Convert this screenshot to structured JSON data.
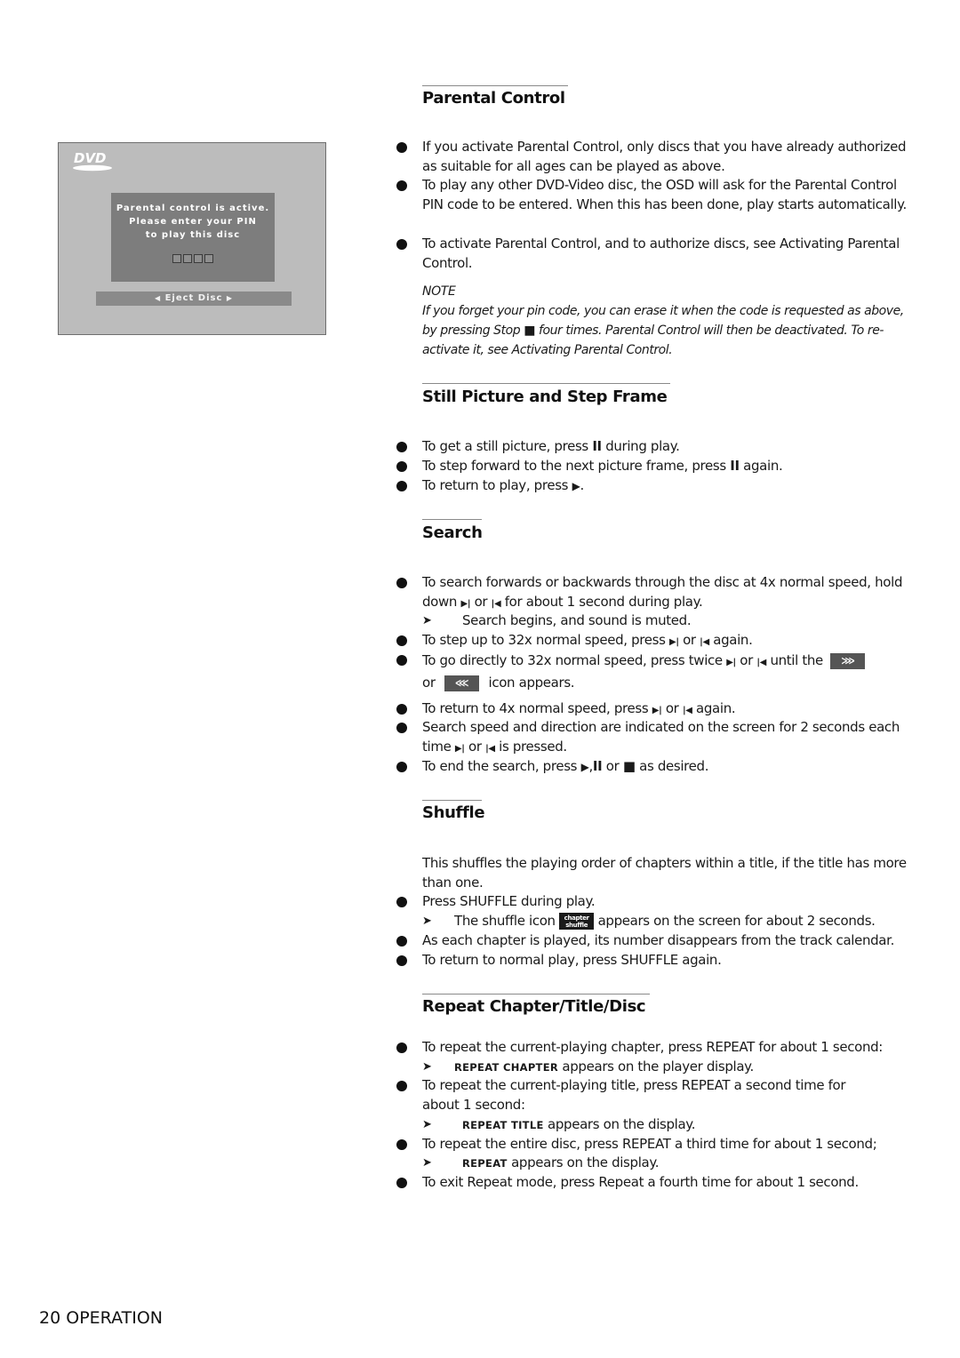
{
  "osd": {
    "logo": "DVD",
    "dialog_lines": [
      "Parental control is active.",
      "Please enter your PIN",
      "to play this disc"
    ],
    "pin_digits": 4,
    "eject_label": "Eject Disc"
  },
  "sections": {
    "parental": {
      "title": "Parental Control",
      "bullets": [
        "If you activate Parental Control, only discs that you have already authorized as suitable for all ages can be played as above.",
        "To play any other DVD-Video disc, the OSD will ask for the Parental Control PIN code to be entered. When this has been done, play starts automatically.",
        "To activate Parental Control, and to authorize discs, see Activating Parental Control."
      ],
      "note_heading": "NOTE",
      "note_part1": "If you forget your pin code, you can erase it when the code is requested as above, by pressing Stop",
      "note_symbol": "■",
      "note_part2": "four times. Parental Control will then be deactivated. To re-activate it, see Activating Parental Control."
    },
    "still": {
      "title": "Still Picture and Step Frame",
      "b1_a": "To get a still picture, press",
      "b1_sym": "II",
      "b1_b": "during play.",
      "b2_a": "To step forward to the next picture frame, press",
      "b2_sym": "II",
      "b2_b": "again.",
      "b3_a": "To return to play, press",
      "b3_sym": "▶",
      "b3_b": "."
    },
    "search": {
      "title": "Search",
      "next_sym": "▶|",
      "prev_sym": "|◀",
      "b1_a": "To search forwards or backwards through the disc at 4x normal speed, hold down",
      "b1_or": "or",
      "b1_b": "for about 1 second during play.",
      "b1_sub": "Search begins, and sound is muted.",
      "b2_a": "To step up to 32x normal speed, press",
      "b2_or": "or",
      "b2_b": "again.",
      "b3_a": "To go directly to 32x normal speed, press twice",
      "b3_or": "or",
      "b3_b": "until the",
      "b3_ff_icon": "⋙",
      "b3_or2": "or",
      "b3_rw_icon": "⋘",
      "b3_c": "icon appears.",
      "b4_a": "To return to 4x normal speed, press",
      "b4_or": "or",
      "b4_b": "again.",
      "b5_a": "Search speed and direction are indicated on the screen for 2 seconds each time",
      "b5_or": "or",
      "b5_b": "is pressed.",
      "b6_a": "To end the search, press",
      "b6_play": "▶",
      "b6_pause": "II",
      "b6_or": "or",
      "b6_stop": "■",
      "b6_b": "as desired."
    },
    "shuffle": {
      "title": "Shuffle",
      "intro": "This shuffles the playing order of chapters within a title, if the title has more than one.",
      "b1": "Press SHUFFLE during play.",
      "b1_sub_a": "The shuffle icon",
      "icon_line1": "chapter",
      "icon_line2": "shuffle",
      "b1_sub_b": "appears on the screen for about 2 seconds.",
      "b2": "As each chapter is played, its number disappears from the track calendar.",
      "b3": "To return to normal play, press SHUFFLE again."
    },
    "repeat": {
      "title": "Repeat Chapter/Title/Disc",
      "b1": "To repeat the current-playing chapter, press REPEAT for about 1 second:",
      "b1_sub_b": "REPEAT CHAPTER",
      "b1_sub": "appears on the player display.",
      "b2": "To repeat the current-playing title, press REPEAT a second time for about 1 second:",
      "b2_sub_b": "REPEAT TITLE",
      "b2_sub": "appears on the display.",
      "b3": "To repeat the entire disc, press REPEAT a third time for about 1 second;",
      "b3_sub_b": "REPEAT",
      "b3_sub": "appears on the display.",
      "b4": "To exit Repeat mode, press Repeat a fourth time for about 1 second."
    }
  },
  "arrow_glyph": "➤",
  "footer": {
    "page_number": "20",
    "section": "OPERATION"
  }
}
